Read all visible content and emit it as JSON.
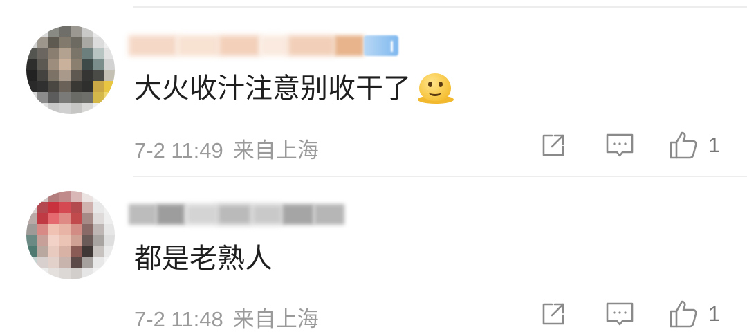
{
  "comments": [
    {
      "text": "大火收汁注意别收干了",
      "emoji_icon": "melting-face-emoji",
      "date": "7-2 11:49",
      "location": "来自上海",
      "likes": "1",
      "avatar_note": "pixelated",
      "username_note": "blurred"
    },
    {
      "text": "都是老熟人",
      "date": "7-2 11:48",
      "location": "来自上海",
      "likes": "1",
      "avatar_note": "pixelated",
      "username_note": "blurred"
    }
  ],
  "icons": {
    "share": "share-icon",
    "reply": "comment-icon",
    "like": "thumbs-up-icon"
  },
  "colors": {
    "text": "#1e1e1e",
    "meta": "#9a9a9a",
    "icon": "#8a8a8a",
    "divider": "#ededed"
  }
}
